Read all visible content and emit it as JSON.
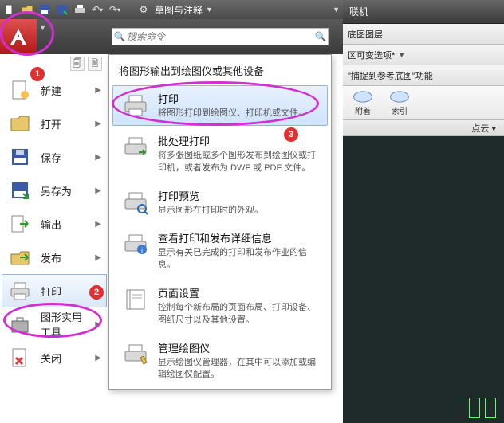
{
  "toolbar": {
    "workspace": "草图与注释"
  },
  "search": {
    "placeholder": "搜索命令"
  },
  "appmenu": {
    "items": [
      {
        "label": "新建",
        "icon": "file-new"
      },
      {
        "label": "打开",
        "icon": "folder-open"
      },
      {
        "label": "保存",
        "icon": "floppy"
      },
      {
        "label": "另存为",
        "icon": "floppy-as"
      },
      {
        "label": "输出",
        "icon": "export"
      },
      {
        "label": "发布",
        "icon": "publish"
      },
      {
        "label": "打印",
        "icon": "printer",
        "selected": true
      },
      {
        "label": "图形实用\n工具",
        "icon": "toolbox"
      },
      {
        "label": "关闭",
        "icon": "close-file"
      }
    ]
  },
  "submenu": {
    "title": "将图形输出到绘图仪或其他设备",
    "items": [
      {
        "head": "打印",
        "desc": "将图形打印到绘图仪、打印机或文件。",
        "hi": true
      },
      {
        "head": "批处理打印",
        "desc": "将多张图纸或多个图形发布到绘图仪或打印机，或者发布为 DWF 或 PDF 文件。"
      },
      {
        "head": "打印预览",
        "desc": "显示图形在打印时的外观。"
      },
      {
        "head": "查看打印和发布详细信息",
        "desc": "显示有关已完成的打印和发布作业的信息。"
      },
      {
        "head": "页面设置",
        "desc": "控制每个新布局的页面布局、打印设备、图纸尺寸以及其他设置。"
      },
      {
        "head": "管理绘图仪",
        "desc": "显示绘图仪管理器，在其中可以添加或编辑绘图仪配置。"
      }
    ]
  },
  "right": {
    "tab": "联机",
    "row1": "底图图层",
    "row2": "区可变选项*",
    "row3": "\"捕捉到参考底图\"功能",
    "btn1": "附着",
    "btn2": "索引",
    "foot": "点云 ▾"
  }
}
